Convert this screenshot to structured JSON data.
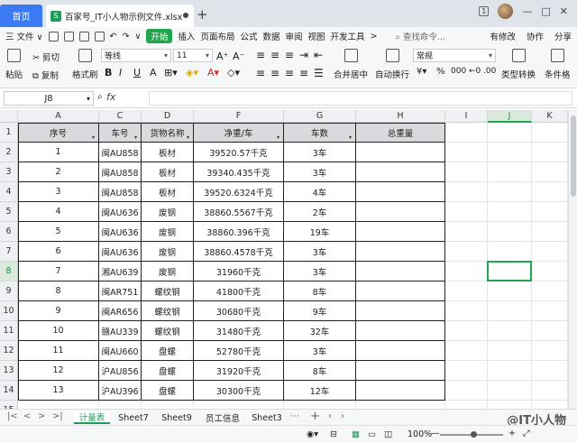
{
  "titlebar": {
    "home_tab": "首页",
    "file_tab": "百家号_IT小人物示例文件.xlsx",
    "add_tab": "+",
    "badge": "1",
    "win_min": "—",
    "win_max": "□",
    "win_close": "✕"
  },
  "menu": {
    "file": "三 文件 ∨",
    "start": "开始",
    "items": [
      "插入",
      "页面布局",
      "公式",
      "数据",
      "审阅",
      "视图",
      "开发工具",
      ">"
    ],
    "search": "查找命令...",
    "edit_badge": "有修改",
    "collab": "协作",
    "share": "分享"
  },
  "ribbon": {
    "paste": "粘贴",
    "cut": "剪切",
    "copy": "复制",
    "format_painter": "格式刷",
    "font_name": "等线",
    "font_size": "11",
    "bold": "B",
    "italic": "I",
    "underline": "U",
    "merge": "合并居中",
    "wrap": "自动换行",
    "number_format": "常规",
    "type_convert": "类型转换",
    "cond_format": "条件格",
    "percent": "%",
    "thousands": "000",
    "currency": "¥"
  },
  "formula_bar": {
    "cell_ref": "J8",
    "fx": "fx",
    "formula": ""
  },
  "columns": [
    "A",
    "C",
    "D",
    "F",
    "G",
    "H",
    "I",
    "J",
    "K"
  ],
  "selected_column": "J",
  "selected_row": "8",
  "table": {
    "headers": [
      "序号",
      "车号",
      "货物名称",
      "净重/车",
      "车数",
      "总重量"
    ],
    "rows": [
      {
        "n": "2",
        "cells": [
          "1",
          "闽AU858",
          "板材",
          "39520.57千克",
          "3车",
          ""
        ]
      },
      {
        "n": "3",
        "cells": [
          "2",
          "闽AU858",
          "板材",
          "39340.435千克",
          "3车",
          ""
        ]
      },
      {
        "n": "4",
        "cells": [
          "3",
          "闽AU858",
          "板材",
          "39520.6324千克",
          "4车",
          ""
        ]
      },
      {
        "n": "5",
        "cells": [
          "4",
          "闽AU636",
          "废钢",
          "38860.5567千克",
          "2车",
          ""
        ]
      },
      {
        "n": "6",
        "cells": [
          "5",
          "闽AU636",
          "废钢",
          "38860.396千克",
          "19车",
          ""
        ]
      },
      {
        "n": "7",
        "cells": [
          "6",
          "闽AU636",
          "废钢",
          "38860.4578千克",
          "3车",
          ""
        ]
      },
      {
        "n": "8",
        "cells": [
          "7",
          "湘AU639",
          "废钢",
          "31960千克",
          "3车",
          ""
        ]
      },
      {
        "n": "9",
        "cells": [
          "8",
          "闽AR751",
          "螺纹钢",
          "41800千克",
          "8车",
          ""
        ]
      },
      {
        "n": "10",
        "cells": [
          "9",
          "闽AR656",
          "螺纹钢",
          "30680千克",
          "9车",
          ""
        ]
      },
      {
        "n": "11",
        "cells": [
          "10",
          "赣AU339",
          "螺纹钢",
          "31480千克",
          "32车",
          ""
        ]
      },
      {
        "n": "12",
        "cells": [
          "11",
          "闽AU660",
          "盘螺",
          "52780千克",
          "3车",
          ""
        ]
      },
      {
        "n": "13",
        "cells": [
          "12",
          "沪AU856",
          "盘螺",
          "31920千克",
          "8车",
          ""
        ]
      },
      {
        "n": "14",
        "cells": [
          "13",
          "沪AU396",
          "盘螺",
          "30300千克",
          "12车",
          ""
        ]
      }
    ]
  },
  "sheets": {
    "nav": [
      "|<",
      "<",
      ">",
      ">|"
    ],
    "tabs": [
      "计量表",
      "Sheet7",
      "Sheet9",
      "员工信息",
      "Sheet3"
    ],
    "active": "计量表",
    "add": "+"
  },
  "status": {
    "zoom": "100%",
    "minus": "—",
    "watermark": "@IT小人物"
  },
  "colors": {
    "accent": "#22a64d",
    "home_tab": "#3a7af2",
    "header_fill": "#d9dadd"
  }
}
